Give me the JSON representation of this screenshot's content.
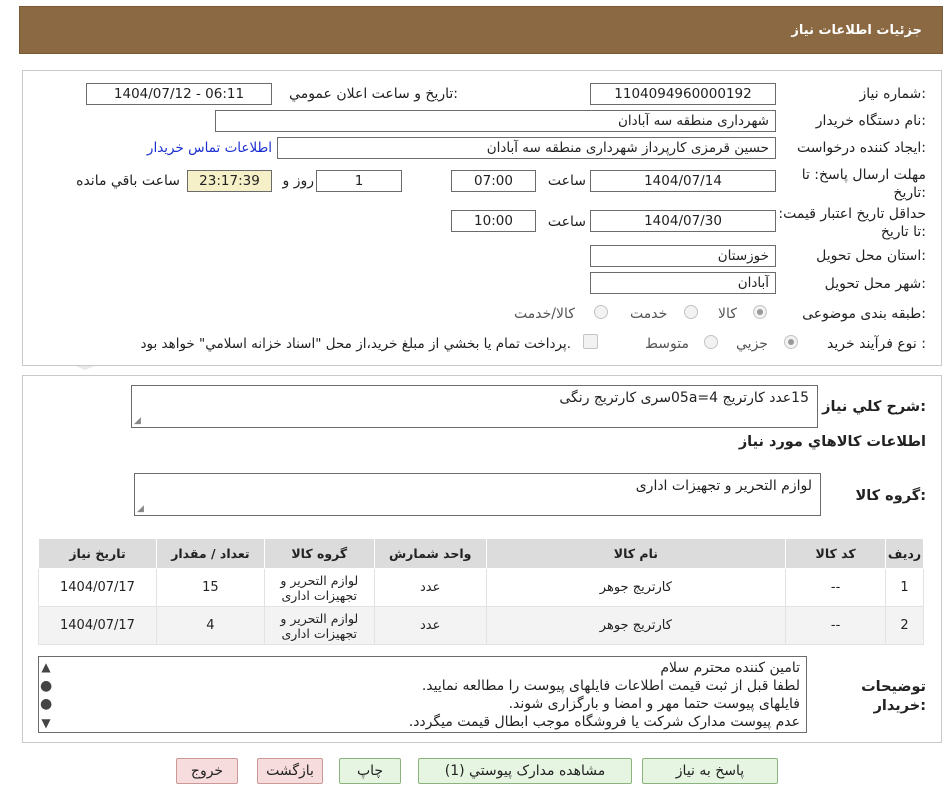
{
  "header": {
    "title": "جزئیات اطلاعات نیاز"
  },
  "form": {
    "need_number": {
      "label": "شماره نیاز:",
      "value": "1104094960000192"
    },
    "announce_datetime": {
      "label": "تاریخ و ساعت اعلان عمومي:",
      "value": "1404/07/12 - 06:11"
    },
    "buyer_org": {
      "label": "نام دستگاه خريدار:",
      "value": "شهرداری منطقه سه آبادان"
    },
    "requester": {
      "label": "ايجاد کننده درخواست:",
      "value": "حسين قرمزی کارپرداز شهرداری منطقه سه آبادان",
      "contact_link": "اطلاعات تماس خريدار"
    },
    "deadline": {
      "label": "مهلت ارسال پاسخ: تا تاريخ:",
      "date": "1404/07/14",
      "time_label": "ساعت",
      "time": "07:00",
      "days": "1",
      "days_label": "روز و",
      "remaining": "23:17:39",
      "remaining_label": "ساعت باقي مانده"
    },
    "price_validity": {
      "label": "حداقل تاريخ اعتبار قيمت: تا تاريخ:",
      "date": "1404/07/30",
      "time_label": "ساعت",
      "time": "10:00"
    },
    "province": {
      "label": "استان محل تحويل:",
      "value": "خوزستان"
    },
    "city": {
      "label": "شهر محل تحويل:",
      "value": "آبادان"
    },
    "category": {
      "label": "طبقه بندی موضوعی:",
      "options": [
        "کالا",
        "خدمت",
        "کالا/خدمت"
      ]
    },
    "process": {
      "label": "نوع فرآيند خريد :",
      "options": [
        "جزيي",
        "متوسط"
      ],
      "payment_note": "پرداخت تمام يا بخشي از مبلغ خريد،از محل \"اسناد خزانه اسلامي\" خواهد بود."
    }
  },
  "description": {
    "label": "شرح کلي نياز:",
    "value": "15عدد کارتریج 4=05aسری کارتریج رنگی"
  },
  "goods_section": {
    "title": "اطلاعات کالاهاي مورد نياز",
    "group_label": "گروه کالا:",
    "group_value": "لوازم التحرير و تجهيزات اداری"
  },
  "table": {
    "headers": [
      "رديف",
      "کد کالا",
      "نام کالا",
      "واحد شمارش",
      "گروه کالا",
      "تعداد / مقدار",
      "تاريخ نياز"
    ],
    "rows": [
      {
        "row": "1",
        "code": "--",
        "name": "کارتریج جوهر",
        "unit": "عدد",
        "group": "لوازم التحرير و تجهيزات اداری",
        "qty": "15",
        "date": "1404/07/17"
      },
      {
        "row": "2",
        "code": "--",
        "name": "کارتریج جوهر",
        "unit": "عدد",
        "group": "لوازم التحرير و تجهيزات اداری",
        "qty": "4",
        "date": "1404/07/17"
      }
    ]
  },
  "buyer_notes": {
    "label": "توضيحات خريدار:",
    "lines": [
      "تامین کننده محترم سلام",
      "لطفا قبل از ثبت قیمت اطلاعات فایلهای پیوست را مطالعه نمایید.",
      "فایلهای پیوست حتما مهر و امضا و بارگزاری شوند.",
      "عدم پیوست مدارک شرکت یا فروشگاه موجب ابطال قیمت میگردد."
    ]
  },
  "buttons": {
    "reply": "پاسخ به نياز",
    "attachments": "مشاهده مدارک پيوستي (1)",
    "print": "چاپ",
    "back": "بازگشت",
    "exit": "خروج"
  },
  "watermark": {
    "text": "AriaTender.neT"
  },
  "colors": {
    "header_bg": "#8b6a43",
    "link": "#1b2fd1",
    "remaining_bg": "#f5f0c8"
  }
}
